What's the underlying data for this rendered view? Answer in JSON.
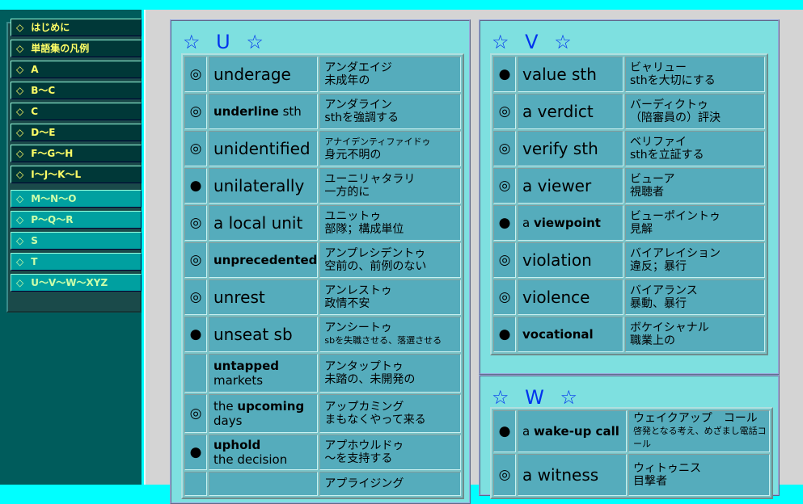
{
  "sidebar": {
    "items": [
      {
        "diamond": "◇",
        "label": "はじめに",
        "style": "dark"
      },
      {
        "diamond": "◇",
        "label": "単語集の凡例",
        "style": "dark"
      },
      {
        "diamond": "◇",
        "label": "A",
        "style": "dark"
      },
      {
        "diamond": "◇",
        "label": "B～C",
        "style": "dark"
      },
      {
        "diamond": "◇",
        "label": "C",
        "style": "dark"
      },
      {
        "diamond": "◇",
        "label": "D～E",
        "style": "dark"
      },
      {
        "diamond": "◇",
        "label": "F～G～H",
        "style": "dark"
      },
      {
        "diamond": "◇",
        "label": "I～J～K～L",
        "style": "dark"
      },
      {
        "diamond": "◇",
        "label": "M～N～O",
        "style": "light"
      },
      {
        "diamond": "◇",
        "label": "P～Q～R",
        "style": "light"
      },
      {
        "diamond": "◇",
        "label": "S",
        "style": "light"
      },
      {
        "diamond": "◇",
        "label": "T",
        "style": "light"
      },
      {
        "diamond": "◇",
        "label": "U～V～W～XYZ",
        "style": "light"
      }
    ]
  },
  "sections": {
    "U": {
      "star_left": "☆",
      "letter": "U",
      "star_right": "☆",
      "rows": [
        {
          "mark": "◎",
          "pre": "",
          "word": "underage",
          "post": "",
          "bold": false,
          "size": "big",
          "reading": "アンダエイジ",
          "meaning": "未成年の"
        },
        {
          "mark": "◎",
          "pre": "",
          "word": "underline",
          "post": " sth",
          "bold": true,
          "size": "small",
          "reading": "アンダライン",
          "meaning": "sthを強調する"
        },
        {
          "mark": "◎",
          "pre": "",
          "word": "unidentified",
          "post": "",
          "bold": false,
          "size": "big",
          "reading": "アナイデンティファイドゥ",
          "meaning": "身元不明の",
          "reading_tiny": true
        },
        {
          "mark": "●",
          "pre": "",
          "word": "unilaterally",
          "post": "",
          "bold": false,
          "size": "big",
          "reading": "ユーニリャタラリ",
          "meaning": "一方的に"
        },
        {
          "mark": "◎",
          "pre": "a local ",
          "word": "unit",
          "post": "",
          "bold": false,
          "size": "big",
          "reading": "ユニットゥ",
          "meaning": "部隊；構成単位"
        },
        {
          "mark": "◎",
          "pre": "",
          "word": "unprecedented",
          "post": "",
          "bold": true,
          "size": "small",
          "reading": "アンプレシデントゥ",
          "meaning": "空前の、前例のない"
        },
        {
          "mark": "◎",
          "pre": "",
          "word": "unrest",
          "post": "",
          "bold": false,
          "size": "big",
          "reading": "アンレストゥ",
          "meaning": "政情不安"
        },
        {
          "mark": "●",
          "pre": "",
          "word": "unseat",
          "post": " sb",
          "bold": false,
          "size": "big",
          "reading": "アンシートゥ",
          "meaning": "sbを失職させる、落選させる",
          "meaning_tiny": true
        },
        {
          "mark": "",
          "pre": "",
          "word": "untapped",
          "post": " markets",
          "bold": true,
          "size": "small",
          "break": true,
          "reading": "アンタップトゥ",
          "meaning": "未踏の、未開発の"
        },
        {
          "mark": "◎",
          "pre": "the ",
          "word": "upcoming",
          "post": " days",
          "bold": true,
          "size": "small",
          "break": true,
          "reading": "アップカミング",
          "meaning": "まもなくやって来る"
        },
        {
          "mark": "●",
          "pre": "",
          "word": "uphold",
          "post": " the decision",
          "bold": true,
          "size": "small",
          "break": true,
          "reading": "アプホウルドゥ",
          "meaning": "～を支持する"
        },
        {
          "mark": "",
          "pre": "",
          "word": "",
          "post": "",
          "bold": false,
          "size": "small",
          "reading": "アプライジング",
          "meaning": ""
        }
      ]
    },
    "V": {
      "star_left": "☆",
      "letter": "V",
      "star_right": "☆",
      "rows": [
        {
          "mark": "●",
          "pre": "",
          "word": "value",
          "post": " sth",
          "bold": false,
          "size": "big",
          "reading": "ビャリュー",
          "meaning": "sthを大切にする"
        },
        {
          "mark": "◎",
          "pre": "a ",
          "word": "verdict",
          "post": "",
          "bold": false,
          "size": "big",
          "reading": "バーディクトゥ",
          "meaning": "（陪審員の）評決"
        },
        {
          "mark": "◎",
          "pre": "",
          "word": "verify",
          "post": " sth",
          "bold": false,
          "size": "big",
          "reading": "ベリファイ",
          "meaning": "sthを立証する"
        },
        {
          "mark": "◎",
          "pre": "a ",
          "word": "viewer",
          "post": "",
          "bold": false,
          "size": "big",
          "reading": "ビューア",
          "meaning": "視聴者"
        },
        {
          "mark": "●",
          "pre": "a ",
          "word": "viewpoint",
          "post": "",
          "bold": true,
          "size": "small",
          "reading": "ビューポイントゥ",
          "meaning": "見解"
        },
        {
          "mark": "◎",
          "pre": "",
          "word": "violation",
          "post": "",
          "bold": false,
          "size": "big",
          "reading": "バイアレイション",
          "meaning": "違反；暴行"
        },
        {
          "mark": "◎",
          "pre": "",
          "word": "violence",
          "post": "",
          "bold": false,
          "size": "big",
          "reading": "バイアランス",
          "meaning": "暴動、暴行"
        },
        {
          "mark": "●",
          "pre": "",
          "word": "vocational",
          "post": "",
          "bold": true,
          "size": "small",
          "reading": "ボケイシャナル",
          "meaning": "職業上の"
        }
      ]
    },
    "W": {
      "star_left": "☆",
      "letter": "W",
      "star_right": "☆",
      "rows": [
        {
          "mark": "●",
          "pre": "a ",
          "word": "wake-up call",
          "post": "",
          "bold": true,
          "size": "small",
          "reading": "ウェイクアップ　コール",
          "meaning": "啓発となる考え、めざまし電話コール",
          "meaning_tiny": true
        },
        {
          "mark": "◎",
          "pre": "a ",
          "word": "witness",
          "post": "",
          "bold": false,
          "size": "big",
          "reading": "ウィトゥニス",
          "meaning": "目撃者"
        }
      ]
    }
  }
}
